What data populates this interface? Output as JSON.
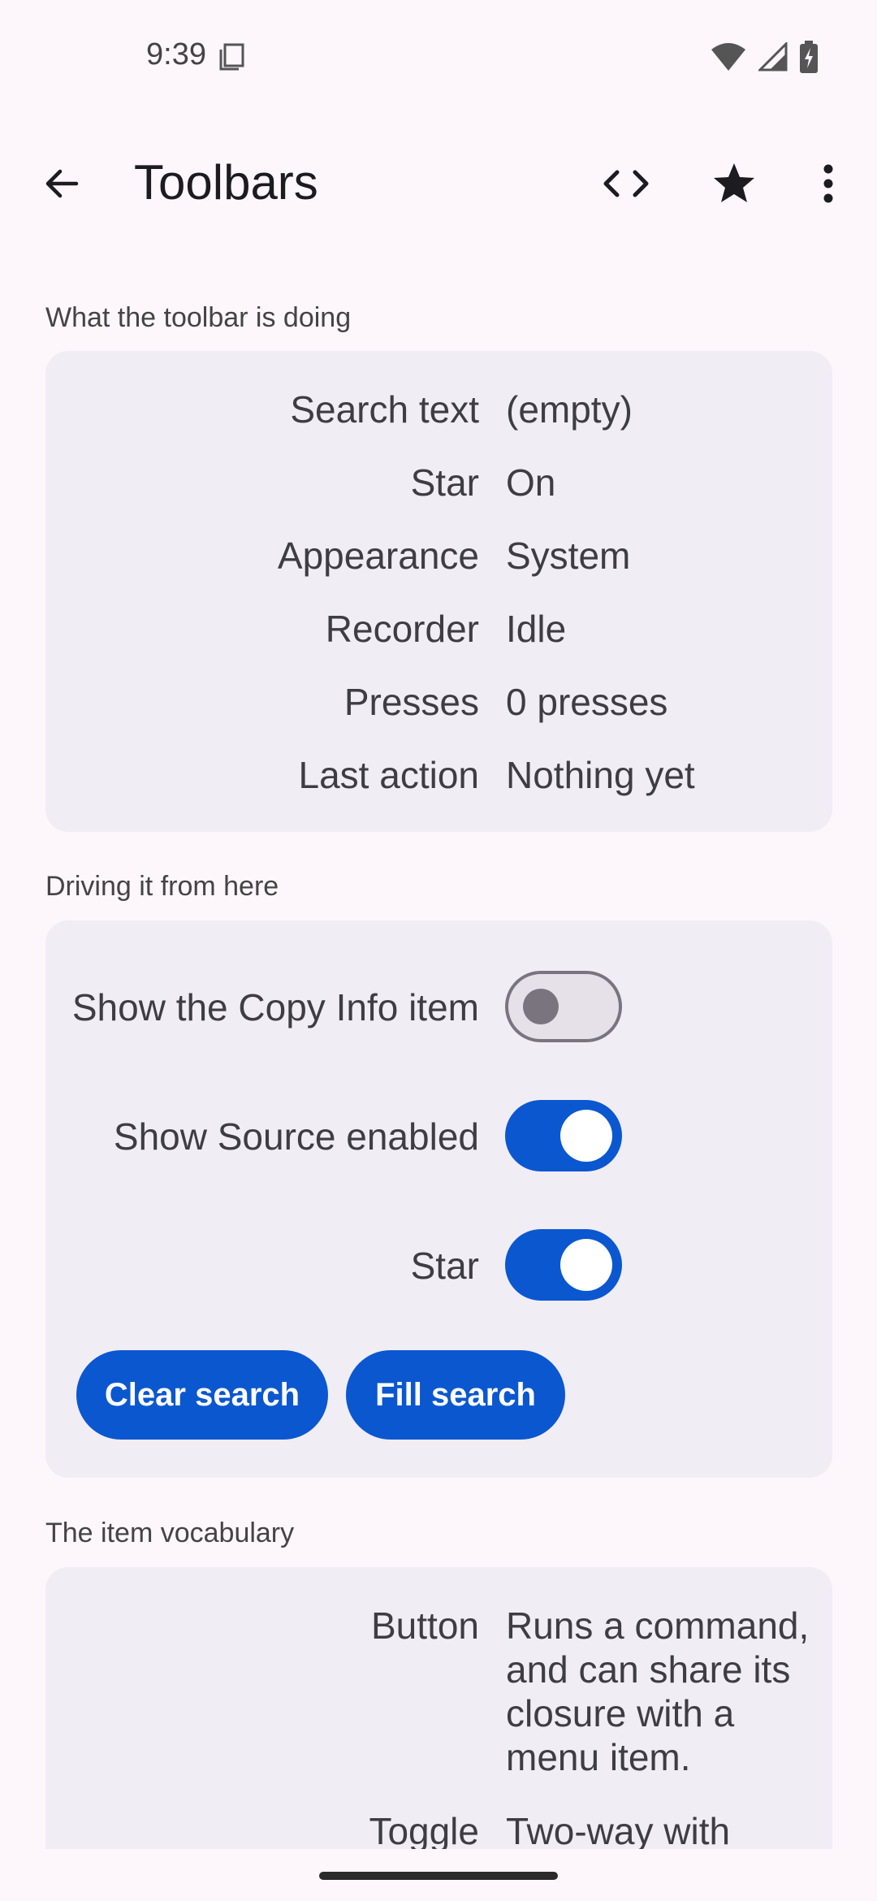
{
  "status": {
    "time": "9:39"
  },
  "appbar": {
    "title": "Toolbars"
  },
  "sections": {
    "state_label": "What the toolbar is doing",
    "driving_label": "Driving it from here",
    "vocab_label": "The item vocabulary"
  },
  "state": [
    {
      "key": "Search text",
      "value": "(empty)"
    },
    {
      "key": "Star",
      "value": "On"
    },
    {
      "key": "Appearance",
      "value": "System"
    },
    {
      "key": "Recorder",
      "value": "Idle"
    },
    {
      "key": "Presses",
      "value": "0 presses"
    },
    {
      "key": "Last action",
      "value": "Nothing yet"
    }
  ],
  "controls": {
    "copy_info": {
      "label": "Show the Copy Info item",
      "checked": false
    },
    "show_source": {
      "label": "Show Source enabled",
      "checked": true
    },
    "star": {
      "label": "Star",
      "checked": true
    },
    "clear_search": "Clear search",
    "fill_search": "Fill search"
  },
  "vocab": [
    {
      "key": "Button",
      "value": "Runs a command, and can share its closure with a menu item."
    },
    {
      "key": "Toggle",
      "value": "Two-way with"
    }
  ],
  "colors": {
    "accent": "#0b57d0",
    "card": "#f1edf5",
    "background": "#fdf7fc"
  }
}
